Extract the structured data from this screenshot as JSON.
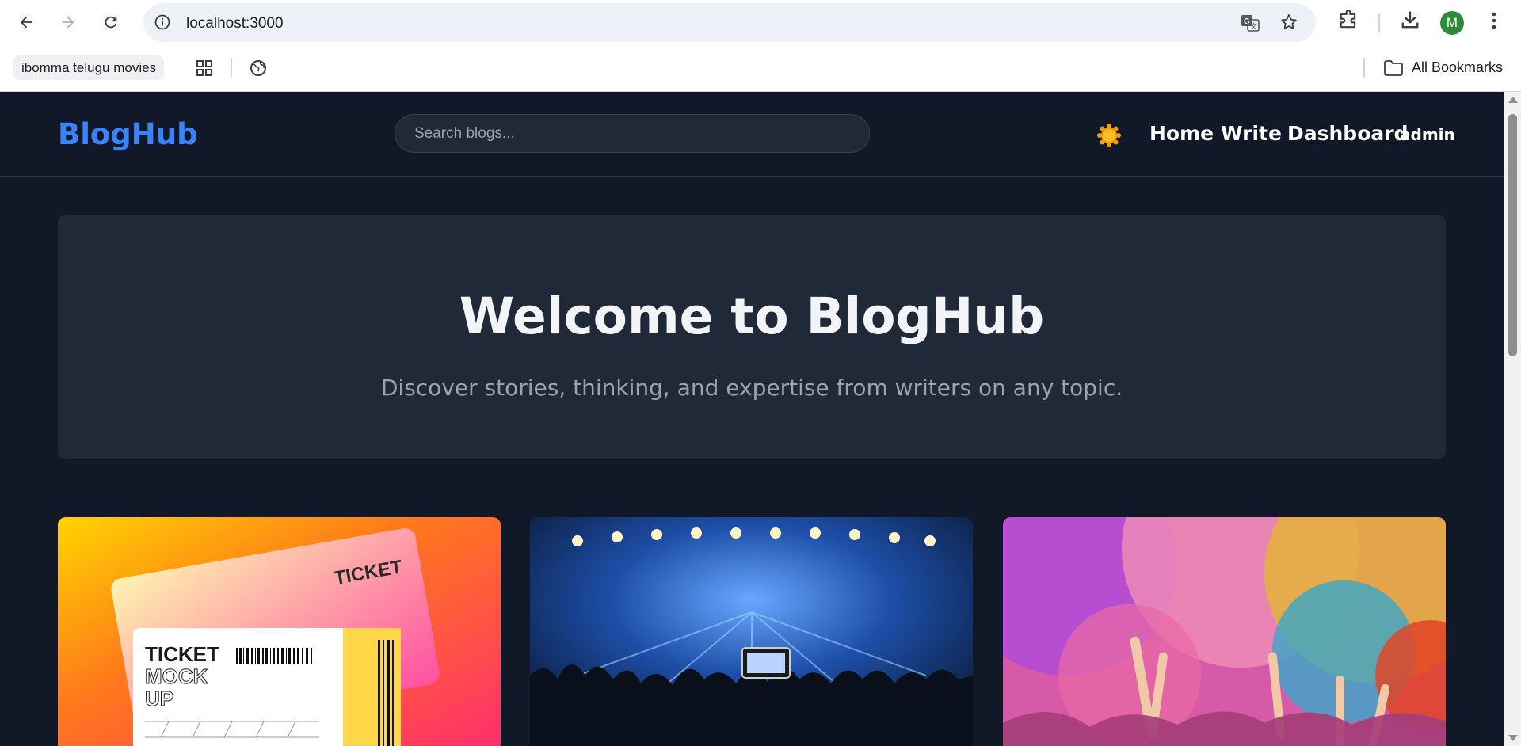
{
  "browser": {
    "url": "localhost:3000",
    "profile_initial": "M",
    "bookmarks": [
      {
        "label": "ibomma telugu movies"
      }
    ],
    "all_bookmarks_label": "All Bookmarks"
  },
  "site": {
    "logo": "BlogHub",
    "search_placeholder": "Search blogs...",
    "nav": {
      "home": "Home",
      "write": "Write",
      "dashboard": "Dashboard",
      "user": "admin"
    },
    "hero": {
      "title": "Welcome to BlogHub",
      "subtitle": "Discover stories, thinking, and expertise from writers on any topic."
    },
    "cards": [
      {
        "image": "ticket-mockup-image",
        "ticket_text": [
          "TICKET",
          "MOCK",
          "UP"
        ]
      },
      {
        "image": "concert-crowd-image"
      },
      {
        "image": "holi-color-festival-image"
      }
    ]
  },
  "colors": {
    "page_bg": "#111827",
    "panel_bg": "#1f2937",
    "accent": "#3b82f6",
    "theme_icon": "#f59e0b"
  }
}
